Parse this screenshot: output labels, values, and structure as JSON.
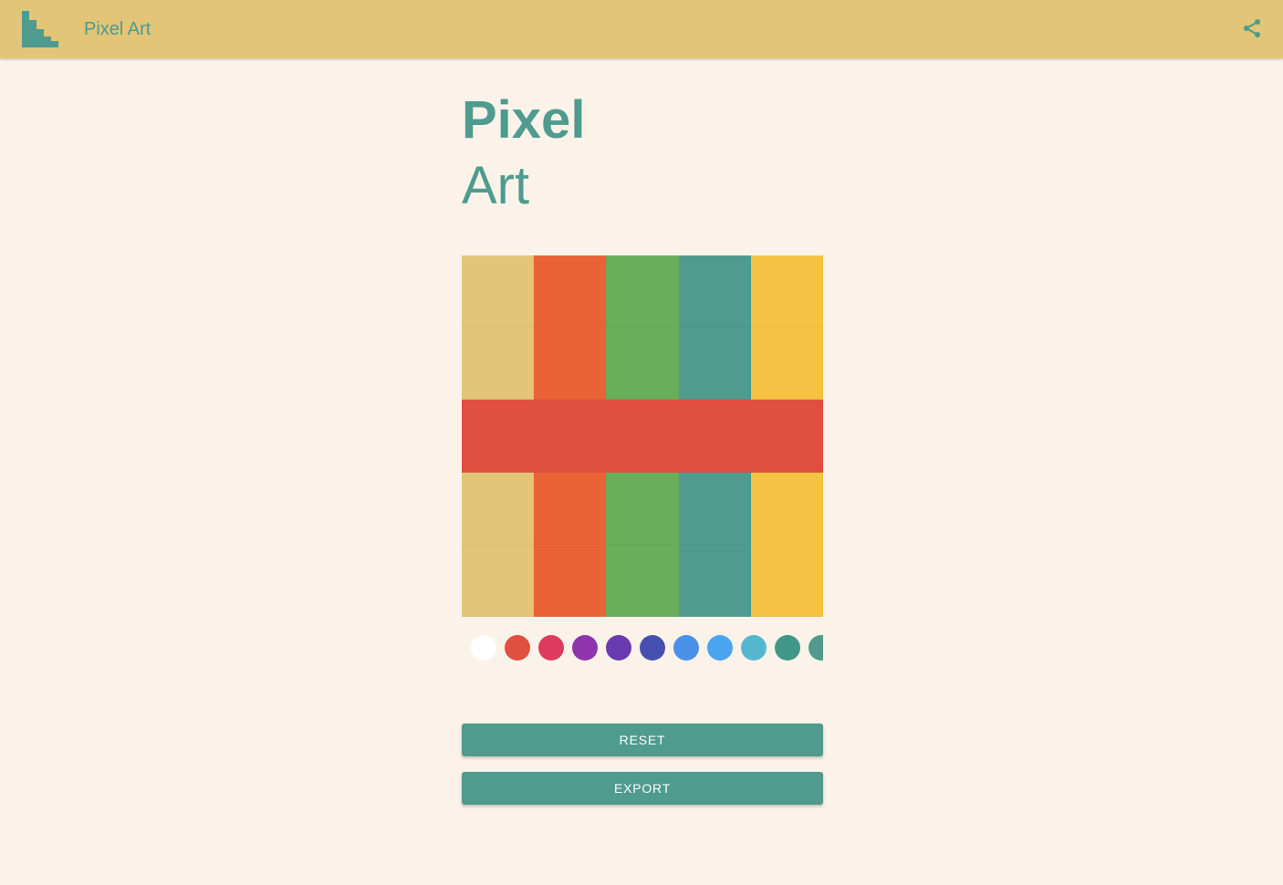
{
  "topbar": {
    "title": "Pixel Art",
    "logo_icon": "pixel-staircase-logo",
    "share_icon": "share-icon",
    "background": "#e2c577"
  },
  "heading": {
    "line1": "Pixel",
    "line2": "Art"
  },
  "canvas": {
    "columns": 5,
    "rows": 5,
    "pixels": [
      [
        "#e2c577",
        "#ea6337",
        "#69ae5b",
        "#4f9b8e",
        "#f5c343"
      ],
      [
        "#e2c577",
        "#ea6337",
        "#69ae5b",
        "#4f9b8e",
        "#f5c343"
      ],
      [
        "#e04f3f",
        "#e04f3f",
        "#e04f3f",
        "#e04f3f",
        "#e04f3f"
      ],
      [
        "#e2c577",
        "#ea6337",
        "#69ae5b",
        "#4f9b8e",
        "#f5c343"
      ],
      [
        "#e2c577",
        "#ea6337",
        "#69ae5b",
        "#4f9b8e",
        "#f5c343"
      ]
    ]
  },
  "palette": {
    "colors": [
      "#ffffff",
      "#e04f3f",
      "#dd3a5e",
      "#8e35ad",
      "#6a3ab1",
      "#4650ae",
      "#4a91ea",
      "#4ba5ee",
      "#56b6cf",
      "#409687",
      "#4f9b8e"
    ]
  },
  "buttons": {
    "reset_label": "RESET",
    "export_label": "EXPORT"
  },
  "colors": {
    "accent": "#4f9b8e",
    "background": "#fbf3ea"
  }
}
